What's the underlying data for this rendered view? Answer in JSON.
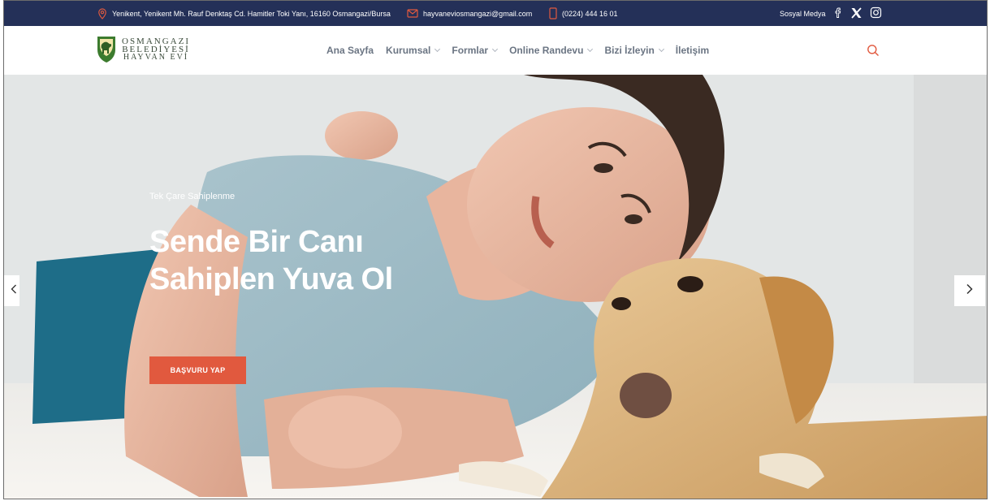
{
  "topbar": {
    "address": "Yenikent, Yenikent Mh. Rauf Denktaş Cd. Hamitler Toki Yanı, 16160 Osmangazi/Bursa",
    "email": "hayvaneviosmangazi@gmail.com",
    "phone": "(0224) 444 16 01",
    "social_label": "Sosyal Medya",
    "social_icons": [
      "facebook-icon",
      "x-icon",
      "instagram-icon"
    ]
  },
  "logo": {
    "line1": "OSMANGAZI",
    "line2": "BELEDİYESİ",
    "line3": "HAYVAN EVİ"
  },
  "nav": {
    "items": [
      {
        "label": "Ana Sayfa",
        "dropdown": false
      },
      {
        "label": "Kurumsal",
        "dropdown": true
      },
      {
        "label": "Formlar",
        "dropdown": true
      },
      {
        "label": "Online Randevu",
        "dropdown": true
      },
      {
        "label": "Bizi İzleyin",
        "dropdown": true
      },
      {
        "label": "İletişim",
        "dropdown": false
      }
    ],
    "search_icon": "search-icon"
  },
  "hero": {
    "eyebrow": "Tek Çare Sahiplenme",
    "headline_line1": "Sende Bir Canı",
    "headline_line2": "Sahiplen Yuva Ol",
    "cta_label": "BAŞVURU YAP"
  },
  "colors": {
    "topbar_bg": "#243058",
    "accent": "#e1593e",
    "nav_text": "#6b7583"
  }
}
